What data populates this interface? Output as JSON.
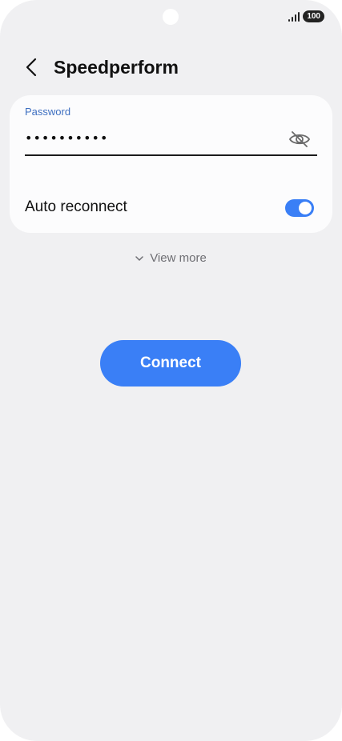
{
  "status_bar": {
    "battery": "100",
    "signal_icon": "signal-bars-icon"
  },
  "header": {
    "title": "Speedperform",
    "back_icon": "back-chevron-icon"
  },
  "password": {
    "label": "Password",
    "value": "••••••••••",
    "visibility_icon": "eye-hidden-icon"
  },
  "auto_reconnect": {
    "label": "Auto reconnect",
    "enabled": true
  },
  "view_more": {
    "label": "View more"
  },
  "connect_button": {
    "label": "Connect"
  },
  "colors": {
    "accent": "#3a7ff6",
    "background": "#f0f0f2",
    "card": "#fcfcfd",
    "label_blue": "#3e6fc0"
  }
}
